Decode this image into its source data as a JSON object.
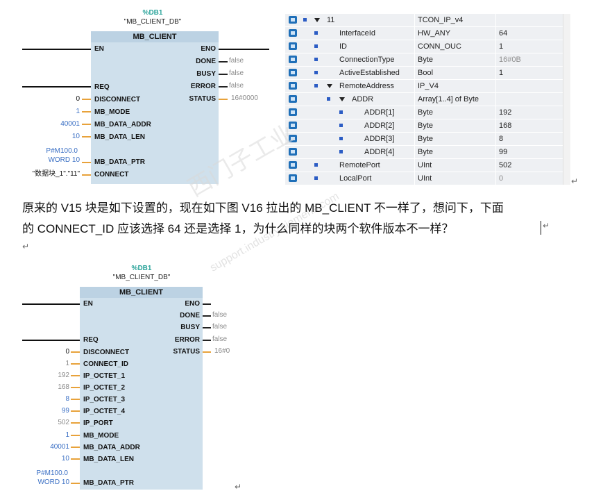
{
  "fb_top": {
    "db_name": "%DB1",
    "instance": "\"MB_CLIENT_DB\"",
    "title": "MB_CLIENT",
    "inputs": [
      {
        "pin": "EN",
        "value": ""
      },
      {
        "pin": "REQ",
        "value": ""
      },
      {
        "pin": "DISCONNECT",
        "value": "0"
      },
      {
        "pin": "MB_MODE",
        "value": "1"
      },
      {
        "pin": "MB_DATA_ADDR",
        "value": "40001"
      },
      {
        "pin": "MB_DATA_LEN",
        "value": "10"
      },
      {
        "pin": "MB_DATA_PTR",
        "value_line1": "P#M100.0",
        "value_line2": "WORD 10"
      },
      {
        "pin": "CONNECT",
        "value": "\"数据块_1\".\"11\""
      }
    ],
    "outputs": [
      {
        "pin": "ENO",
        "value": ""
      },
      {
        "pin": "DONE",
        "value": "false"
      },
      {
        "pin": "BUSY",
        "value": "false"
      },
      {
        "pin": "ERROR",
        "value": "false"
      },
      {
        "pin": "STATUS",
        "value": "16#0000"
      }
    ]
  },
  "table": {
    "rows": [
      {
        "name": "11",
        "type": "TCON_IP_v4",
        "value": ""
      },
      {
        "name": "InterfaceId",
        "type": "HW_ANY",
        "value": "64"
      },
      {
        "name": "ID",
        "type": "CONN_OUC",
        "value": "1"
      },
      {
        "name": "ConnectionType",
        "type": "Byte",
        "value": "16#0B"
      },
      {
        "name": "ActiveEstablished",
        "type": "Bool",
        "value": "1"
      },
      {
        "name": "RemoteAddress",
        "type": "IP_V4",
        "value": ""
      },
      {
        "name": "ADDR",
        "type": "Array[1..4] of Byte",
        "value": ""
      },
      {
        "name": "ADDR[1]",
        "type": "Byte",
        "value": "192"
      },
      {
        "name": "ADDR[2]",
        "type": "Byte",
        "value": "168"
      },
      {
        "name": "ADDR[3]",
        "type": "Byte",
        "value": "8"
      },
      {
        "name": "ADDR[4]",
        "type": "Byte",
        "value": "99"
      },
      {
        "name": "RemotePort",
        "type": "UInt",
        "value": "502"
      },
      {
        "name": "LocalPort",
        "type": "UInt",
        "value": "0"
      }
    ]
  },
  "question": {
    "line1": "原来的 V15 块是如下设置的，现在如下图 V16 拉出的 MB_CLIENT 不一样了，想问下，下面",
    "line2": "的 CONNECT_ID 应该选择 64 还是选择 1，为什么同样的块两个软件版本不一样？",
    "return_mark": "↵"
  },
  "watermark": {
    "text_cn": "西门子工业",
    "text_url": "support.industry.siemens.com"
  },
  "fb_bottom": {
    "db_name": "%DB1",
    "instance": "\"MB_CLIENT_DB\"",
    "title": "MB_CLIENT",
    "inputs": [
      {
        "pin": "EN",
        "value": ""
      },
      {
        "pin": "REQ",
        "value": ""
      },
      {
        "pin": "DISCONNECT",
        "value": "0"
      },
      {
        "pin": "CONNECT_ID",
        "value": "1"
      },
      {
        "pin": "IP_OCTET_1",
        "value": "192"
      },
      {
        "pin": "IP_OCTET_2",
        "value": "168"
      },
      {
        "pin": "IP_OCTET_3",
        "value": "8"
      },
      {
        "pin": "IP_OCTET_4",
        "value": "99"
      },
      {
        "pin": "IP_PORT",
        "value": "502"
      },
      {
        "pin": "MB_MODE",
        "value": "1"
      },
      {
        "pin": "MB_DATA_ADDR",
        "value": "40001"
      },
      {
        "pin": "MB_DATA_LEN",
        "value": "10"
      },
      {
        "pin": "MB_DATA_PTR",
        "value_line1": "P#M100.0",
        "value_line2": "WORD 10"
      }
    ],
    "outputs": [
      {
        "pin": "ENO",
        "value": ""
      },
      {
        "pin": "DONE",
        "value": "false"
      },
      {
        "pin": "BUSY",
        "value": "false"
      },
      {
        "pin": "ERROR",
        "value": "false"
      },
      {
        "pin": "STATUS",
        "value": "16#0"
      }
    ]
  }
}
